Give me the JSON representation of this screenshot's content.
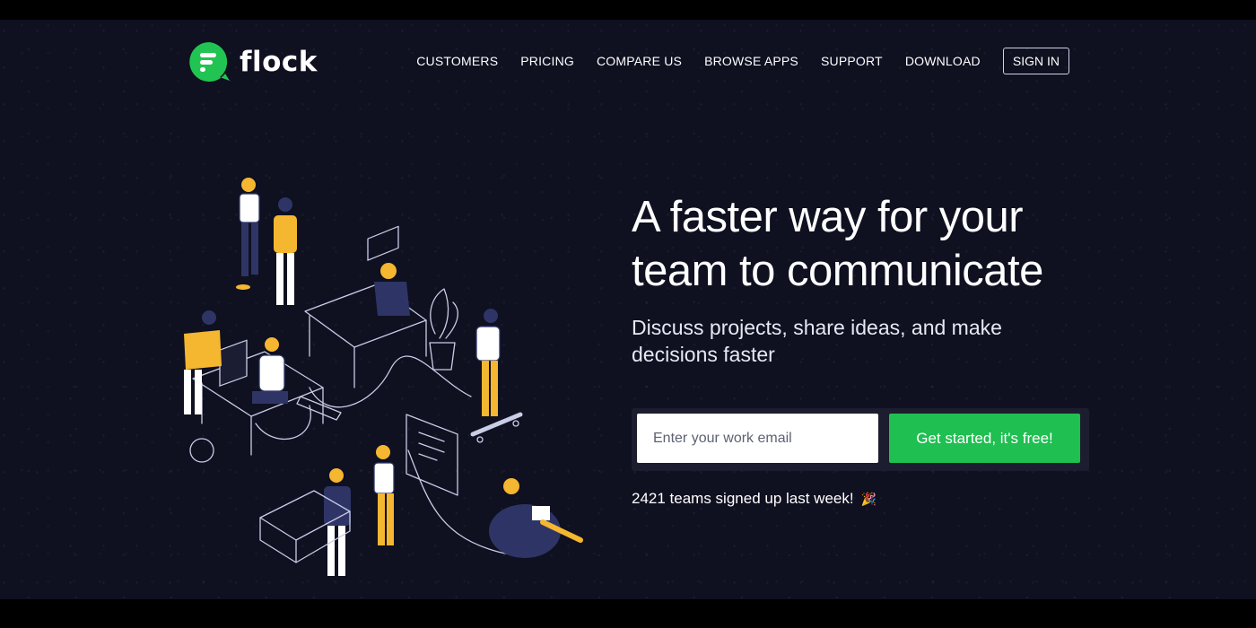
{
  "header": {
    "logo_text": "flock",
    "nav": [
      {
        "label": "CUSTOMERS"
      },
      {
        "label": "PRICING"
      },
      {
        "label": "COMPARE US"
      },
      {
        "label": "BROWSE APPS"
      },
      {
        "label": "SUPPORT"
      },
      {
        "label": "DOWNLOAD"
      }
    ],
    "signin_label": "SIGN IN"
  },
  "hero": {
    "title_line1": "A faster way for your",
    "title_line2": "team to communicate",
    "subtitle_line1": "Discuss projects, share ideas, and make",
    "subtitle_line2": "decisions faster",
    "email_placeholder": "Enter your work email",
    "cta_label": "Get started, it's free!",
    "signups_text": "2421 teams signed up last week!",
    "signups_icon": "party-popper-icon"
  },
  "colors": {
    "background": "#0f1020",
    "brand_green": "#1fbf51",
    "accent_yellow": "#f5b630",
    "figure_navy": "#2e3566"
  }
}
